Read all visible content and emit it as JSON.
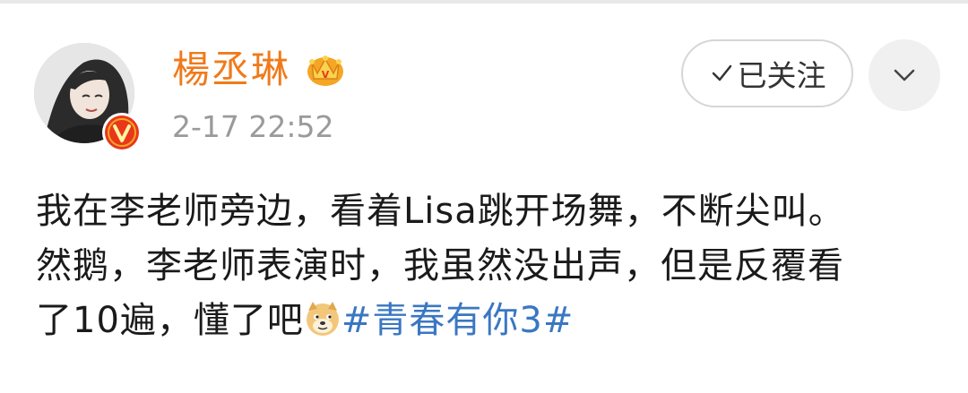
{
  "post": {
    "username": "楊丞琳",
    "timestamp": "2-17 22:52",
    "follow_label": "已关注",
    "text_lines": [
      "我在李老师旁边，看着Lisa跳开场舞，不断尖叫。",
      "然鹅，李老师表演时，我虽然没出声，但是反覆看"
    ],
    "text_line3": "了10遍，懂了吧",
    "hashtag": "#青春有你3#"
  },
  "icons": {
    "avatar": "user-avatar-photo",
    "verified": "verified-v-badge-icon",
    "vip": "crown-icon",
    "follow_check": "check-icon",
    "more": "chevron-down-icon",
    "emoji": "doge-emoji-icon"
  },
  "colors": {
    "username": "#f07a1a",
    "timestamp": "#9a9a9a",
    "hashtag": "#3a77c2",
    "verified_badge": "#e8371b",
    "crown": "#f5a623"
  }
}
